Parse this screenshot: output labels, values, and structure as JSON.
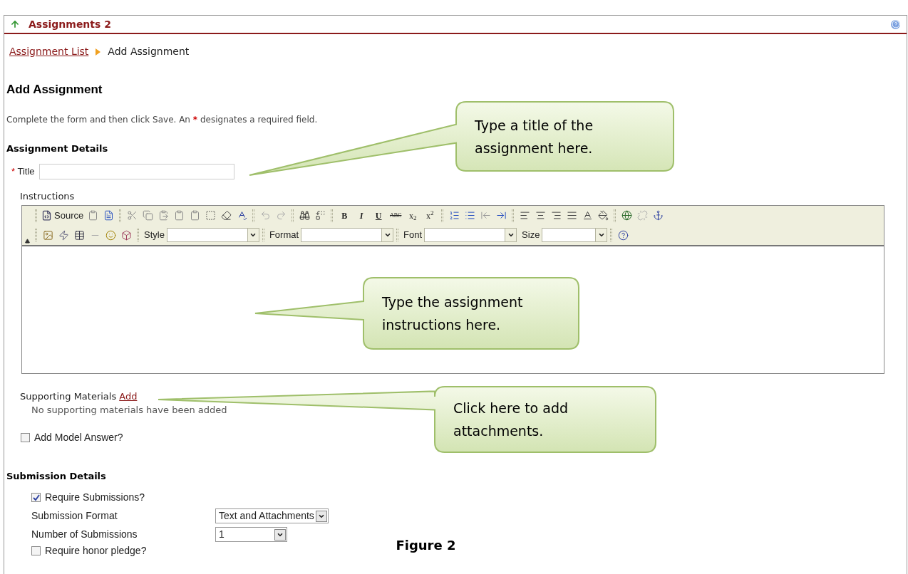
{
  "header": {
    "title": "Assignments 2"
  },
  "breadcrumb": [
    {
      "label": "Assignment List",
      "kind": "link"
    },
    {
      "label": "Add Assignment",
      "kind": "current"
    }
  ],
  "heading": "Add Assignment",
  "intro": [
    "Complete the form and then click Save. An",
    "designates a required field."
  ],
  "required_mark": "*",
  "assignment_details": {
    "heading": "Assignment Details",
    "title_label": "Title",
    "instructions_label": "Instructions"
  },
  "editor": {
    "source_label": "Source",
    "format_buttons": [
      "B",
      "*I*",
      "U",
      "ABC",
      "x$_{2}$",
      "x$^{2}$"
    ],
    "selects": [
      {
        "label": "Style"
      },
      {
        "label": "Format"
      },
      {
        "label": "Font"
      },
      {
        "label": "Size"
      }
    ]
  },
  "supporting_materials": {
    "label": "Supporting Materials",
    "link": "Add",
    "empty_text": "No supporting materials have been added"
  },
  "model_answer": {
    "label": "Add Model Answer?",
    "checked": false
  },
  "submission_details": {
    "heading": "Submission Details",
    "require_submissions": {
      "label": "Require Submissions?",
      "checked": true
    },
    "fields": [
      {
        "label": "Submission Format",
        "value": "Text and Attachments"
      },
      {
        "label": "Number of Submissions",
        "value": "1"
      }
    ],
    "honor_pledge": {
      "label": "Require honor pledge?",
      "checked": false
    }
  },
  "callouts": [
    "Type a title of the assignment here.",
    "Type the assignment instructions here.",
    "Click here to add attachments."
  ],
  "figure_caption": "Figure 2"
}
